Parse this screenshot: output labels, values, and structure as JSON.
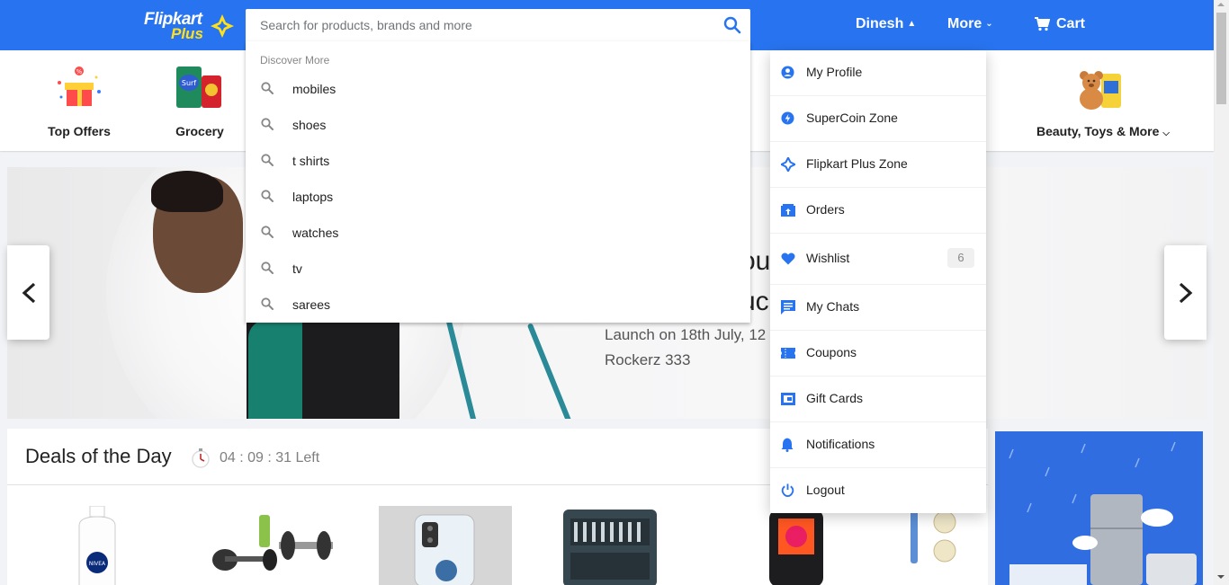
{
  "header": {
    "logo_word": "Flipkart",
    "logo_plus": "Plus",
    "search_placeholder": "Search for products, brands and more",
    "user_name": "Dinesh",
    "more_label": "More",
    "cart_label": "Cart",
    "brand_color": "#2874f0"
  },
  "categories": [
    {
      "label": "Top Offers",
      "icon": "offers-gift-icon"
    },
    {
      "label": "Grocery",
      "icon": "grocery-packs-icon"
    },
    {
      "label": "Beauty, Toys & More",
      "icon": "teddy-bear-icon",
      "has_dropdown": true
    }
  ],
  "banner": {
    "headline_line1": "ou",
    "headline_line2": "uc",
    "line1": "Launch on 18th July, 12",
    "line2": "Rockerz 333"
  },
  "deals": {
    "title": "Deals of the Day",
    "timer": "04 : 09 : 31 Left"
  },
  "search_dropdown": {
    "heading": "Discover More",
    "suggestions": [
      "mobiles",
      "shoes",
      "t shirts",
      "laptops",
      "watches",
      "tv",
      "sarees"
    ]
  },
  "profile_menu": {
    "items": [
      {
        "label": "My Profile",
        "icon": "profile-icon"
      },
      {
        "label": "SuperCoin Zone",
        "icon": "supercoin-icon"
      },
      {
        "label": "Flipkart Plus Zone",
        "icon": "plus-zone-icon"
      },
      {
        "label": "Orders",
        "icon": "orders-icon"
      },
      {
        "label": "Wishlist",
        "icon": "heart-icon",
        "badge": "6"
      },
      {
        "label": "My Chats",
        "icon": "chat-icon"
      },
      {
        "label": "Coupons",
        "icon": "coupon-icon"
      },
      {
        "label": "Gift Cards",
        "icon": "gift-card-icon"
      },
      {
        "label": "Notifications",
        "icon": "bell-icon"
      },
      {
        "label": "Logout",
        "icon": "power-icon"
      }
    ]
  }
}
